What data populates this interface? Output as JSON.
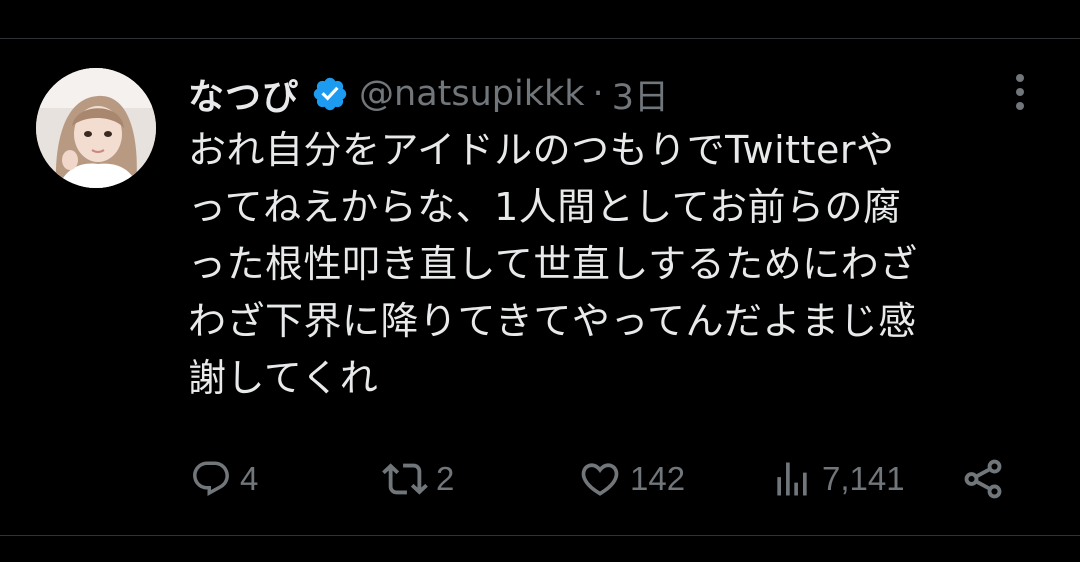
{
  "tweet": {
    "display_name": "なつぴ",
    "handle": "@natsupikkk",
    "separator": "·",
    "time": "3日",
    "text": "おれ自分をアイドルのつもりでTwitterや\nってねえからな、1人間としてお前らの腐\nった根性叩き直して世直しするためにわざ\nわざ下界に降りてきてやってんだよまじ感\n謝してくれ"
  },
  "actions": {
    "replies": "4",
    "retweets": "2",
    "likes": "142",
    "views": "7,141"
  },
  "icons": {
    "verified": "verified-badge-icon",
    "more": "more-vertical-icon",
    "reply": "reply-icon",
    "retweet": "retweet-icon",
    "like": "heart-icon",
    "views": "views-chart-icon",
    "share": "share-icon"
  },
  "colors": {
    "background": "#000000",
    "text": "#e7e9ea",
    "muted": "#71767b",
    "verified": "#1d9bf0",
    "divider": "#2f3336"
  }
}
